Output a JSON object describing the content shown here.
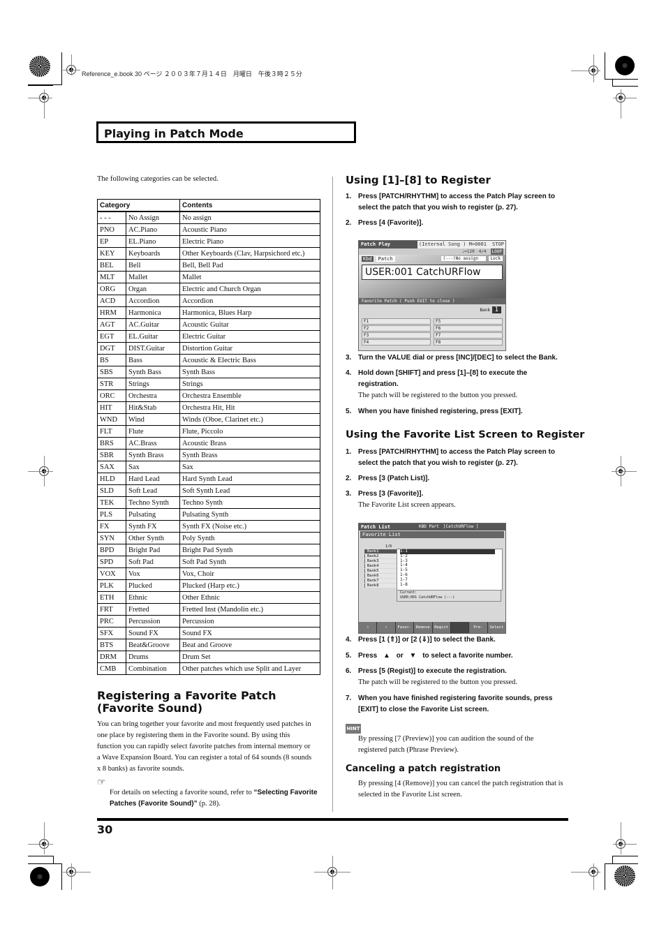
{
  "header": {
    "meta": "Reference_e.book 30 ページ ２００３年７月１４日　月曜日　午後３時２５分",
    "chapter_title": "Playing in Patch Mode"
  },
  "left": {
    "intro": "The following categories can be selected.",
    "table": {
      "headers": [
        "Category",
        "Contents"
      ],
      "rows": [
        [
          "- - -",
          "No Assign",
          "No assign"
        ],
        [
          "PNO",
          "AC.Piano",
          "Acoustic Piano"
        ],
        [
          "EP",
          "EL.Piano",
          "Electric Piano"
        ],
        [
          "KEY",
          "Keyboards",
          "Other Keyboards (Clav, Harpsichord etc.)"
        ],
        [
          "BEL",
          "Bell",
          "Bell, Bell Pad"
        ],
        [
          "MLT",
          "Mallet",
          "Mallet"
        ],
        [
          "ORG",
          "Organ",
          "Electric and Church Organ"
        ],
        [
          "ACD",
          "Accordion",
          "Accordion"
        ],
        [
          "HRM",
          "Harmonica",
          "Harmonica, Blues Harp"
        ],
        [
          "AGT",
          "AC.Guitar",
          "Acoustic Guitar"
        ],
        [
          "EGT",
          "EL.Guitar",
          "Electric Guitar"
        ],
        [
          "DGT",
          "DIST.Guitar",
          "Distortion Guitar"
        ],
        [
          "BS",
          "Bass",
          "Acoustic & Electric Bass"
        ],
        [
          "SBS",
          "Synth Bass",
          "Synth Bass"
        ],
        [
          "STR",
          "Strings",
          "Strings"
        ],
        [
          "ORC",
          "Orchestra",
          "Orchestra Ensemble"
        ],
        [
          "HIT",
          "Hit&Stab",
          "Orchestra Hit, Hit"
        ],
        [
          "WND",
          "Wind",
          "Winds (Oboe, Clarinet etc.)"
        ],
        [
          "FLT",
          "Flute",
          "Flute, Piccolo"
        ],
        [
          "BRS",
          "AC.Brass",
          "Acoustic Brass"
        ],
        [
          "SBR",
          "Synth Brass",
          "Synth Brass"
        ],
        [
          "SAX",
          "Sax",
          "Sax"
        ],
        [
          "HLD",
          "Hard Lead",
          "Hard Synth Lead"
        ],
        [
          "SLD",
          "Soft Lead",
          "Soft Synth Lead"
        ],
        [
          "TEK",
          "Techno Synth",
          "Techno Synth"
        ],
        [
          "PLS",
          "Pulsating",
          "Pulsating Synth"
        ],
        [
          "FX",
          "Synth FX",
          "Synth FX (Noise etc.)"
        ],
        [
          "SYN",
          "Other Synth",
          "Poly Synth"
        ],
        [
          "BPD",
          "Bright Pad",
          "Bright Pad Synth"
        ],
        [
          "SPD",
          "Soft Pad",
          "Soft Pad Synth"
        ],
        [
          "VOX",
          "Vox",
          "Vox, Choir"
        ],
        [
          "PLK",
          "Plucked",
          "Plucked (Harp etc.)"
        ],
        [
          "ETH",
          "Ethnic",
          "Other Ethnic"
        ],
        [
          "FRT",
          "Fretted",
          "Fretted Inst (Mandolin etc.)"
        ],
        [
          "PRC",
          "Percussion",
          "Percussion"
        ],
        [
          "SFX",
          "Sound FX",
          "Sound FX"
        ],
        [
          "BTS",
          "Beat&Groove",
          "Beat and Groove"
        ],
        [
          "DRM",
          "Drums",
          "Drum Set"
        ],
        [
          "CMB",
          "Combination",
          "Other patches which use Split and Layer"
        ]
      ]
    },
    "section_title_line1": "Registering a Favorite Patch",
    "section_title_line2": "(Favorite Sound)",
    "section_body": "You can bring together your favorite and most frequently used patches in one place by registering them in the Favorite sound. By using this function you can rapidly select favorite patches from internal memory or a Wave Expansion Board. You can register a total of 64 sounds (8 sounds x 8 banks) as favorite sounds.",
    "ref_icon": "pointing-hand-icon",
    "ref_text": "For details on selecting a favorite sound, refer to ",
    "ref_link": "“Selecting Favorite Patches (Favorite Sound)”",
    "ref_page": " (p. 28)."
  },
  "right": {
    "sec1_title": "Using [1]–[8] to Register",
    "sec1_steps": [
      {
        "num": "1.",
        "text": "Press [PATCH/RHYTHM] to access the Patch Play screen to select the patch that you wish to register (p. 27)."
      },
      {
        "num": "2.",
        "text": "Press [4 (Favorite)]."
      },
      {
        "num": "3.",
        "text": "Turn the VALUE dial or press [INC]/[DEC] to select the Bank."
      },
      {
        "num": "4.",
        "text": "Hold down [SHIFT] and press [1]–[8] to execute the registration.",
        "note": "The patch will be registered to the button you pressed."
      },
      {
        "num": "5.",
        "text": "When you have finished registering, press [EXIT]."
      }
    ],
    "screen1": {
      "title": "Patch Play",
      "song": "(Internal Song ) M=0001",
      "status": "STOP",
      "tempo": "♩=120",
      "beat": "4/4",
      "loop": "LOOP",
      "kbd": "Kbd",
      "mode": "Patch",
      "assign": "(---)No assign",
      "lock": "Lock",
      "patch_name": "USER:001 CatchURFlow",
      "fav_header": "Favorite Patch ( Push EXIT to close )",
      "bank_label": "Bank",
      "bank_value": "1",
      "slots": [
        "F1",
        "F2",
        "F3",
        "F4",
        "F5",
        "F6",
        "F7",
        "F8"
      ]
    },
    "sec2_title": "Using the Favorite List Screen to Register",
    "sec2_steps": [
      {
        "num": "1.",
        "text": "Press [PATCH/RHYTHM] to access the Patch Play screen to select the patch that you wish to register (p. 27)."
      },
      {
        "num": "2.",
        "text": "Press [3 (Patch List)]."
      },
      {
        "num": "3.",
        "text": "Press [3 (Favorite)].",
        "note": "The Favorite List screen appears."
      },
      {
        "num": "4.",
        "text": "Press [1 (⇑)] or [2 (⇓)] to select the Bank."
      },
      {
        "num": "5.",
        "text_a": "Press",
        "text_b": "or",
        "text_c": "to select a favorite number."
      },
      {
        "num": "6.",
        "text": "Press [5 (Regist)] to execute the registration.",
        "note": "The patch will be registered to the button you pressed."
      },
      {
        "num": "7.",
        "text": "When you have finished registering favorite sounds, press [EXIT] to close the Favorite List screen."
      }
    ],
    "screen2": {
      "title": "Patch List",
      "part": "KBD Part",
      "current_short": "[CatchURFlow ]",
      "subtitle": "Favorite List",
      "page": "1/8",
      "banks": [
        "Bank1",
        "Bank2",
        "Bank3",
        "Bank4",
        "Bank5",
        "Bank6",
        "Bank7",
        "Bank8"
      ],
      "items": [
        "1-1",
        "1-2",
        "1-3",
        "1-4",
        "1-5",
        "1-6",
        "1-7",
        "1-8"
      ],
      "current_label": "Current:",
      "current_value": "USER:001 CatchURFlow (---)",
      "buttons": [
        "⇧",
        "⇩",
        "Favor-ite",
        "Remove",
        "Regist",
        "",
        "Pre-view",
        "Select"
      ]
    },
    "hint_label": "HINT",
    "hint_text": "By pressing [7 (Preview)] you can audition the sound of the registered patch (Phrase Preview).",
    "cancel_title": "Canceling a patch registration",
    "cancel_text": "By pressing [4 (Remove)] you can cancel the patch registration that is selected in the Favorite List screen."
  },
  "footer": {
    "page_number": "30"
  }
}
